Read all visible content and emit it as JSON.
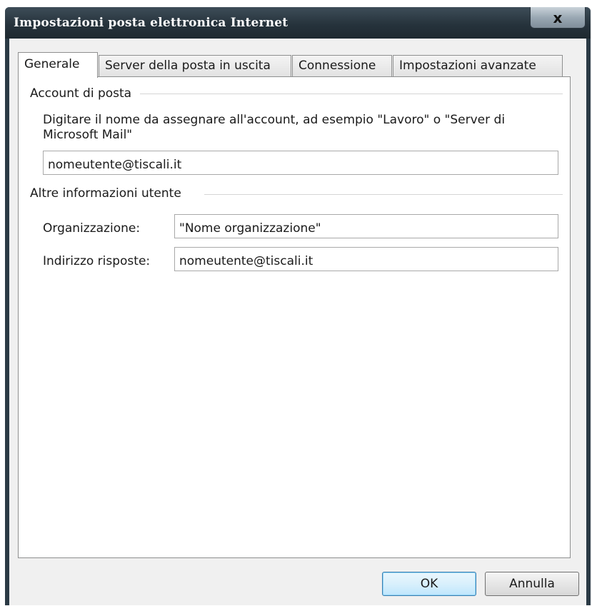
{
  "window": {
    "title": "Impostazioni posta elettronica Internet",
    "close_glyph": "x"
  },
  "tabs": [
    {
      "label": "Generale",
      "active": true
    },
    {
      "label": "Server della posta in uscita",
      "active": false
    },
    {
      "label": "Connessione",
      "active": false
    },
    {
      "label": "Impostazioni avanzate",
      "active": false
    }
  ],
  "account_group": {
    "label": "Account di posta",
    "description_line1": "Digitare il nome da assegnare all'account, ad esempio \"Lavoro\" o \"Server di",
    "description_line2": "Microsoft Mail\"",
    "account_name_value": "nomeutente@tiscali.it"
  },
  "user_info_group": {
    "label": "Altre informazioni utente",
    "organization_label": "Organizzazione:",
    "organization_value": "\"Nome organizzazione\"",
    "reply_address_label": "Indirizzo risposte:",
    "reply_address_value": "nomeutente@tiscali.it"
  },
  "buttons": {
    "ok_label": "OK",
    "cancel_label": "Annulla"
  },
  "colors": {
    "titlebar": "#26333c",
    "dialog_background": "#f0f0f0",
    "default_button_border": "#3c7fb1"
  }
}
